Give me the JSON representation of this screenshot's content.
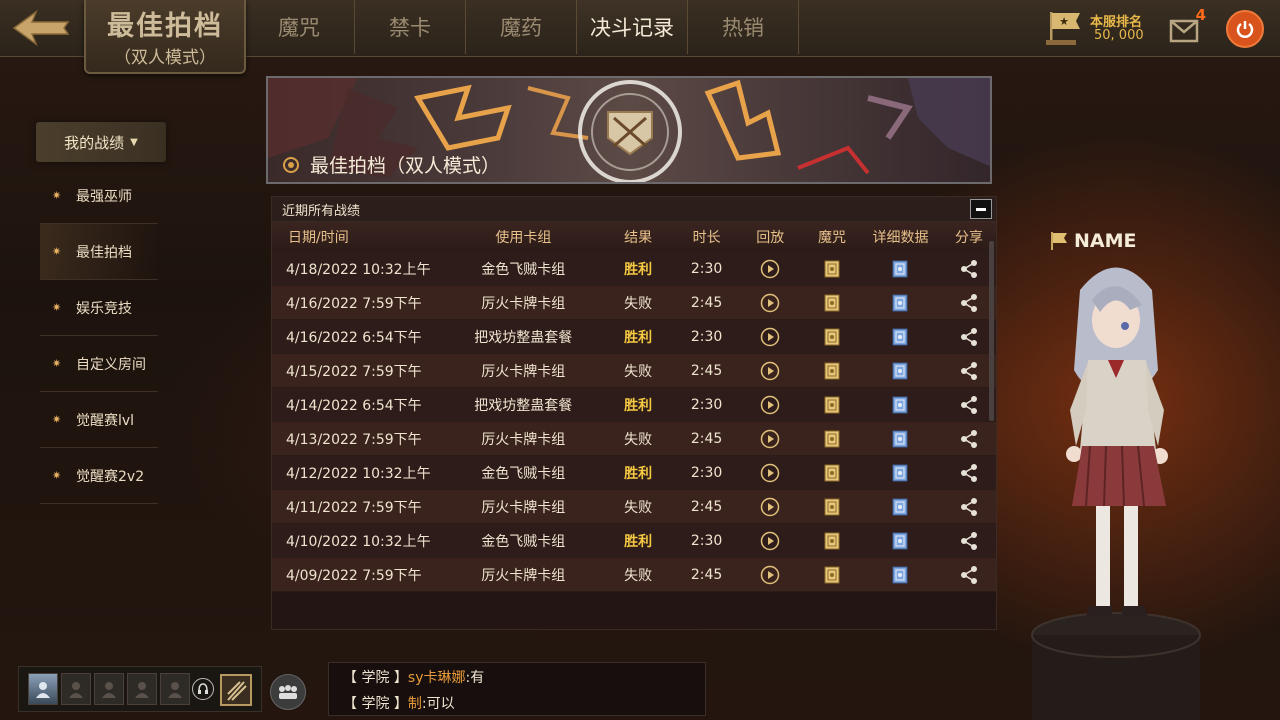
{
  "header": {
    "mode_title": "最佳拍档",
    "mode_subtitle": "（双人模式）",
    "tabs": [
      {
        "label": "魔咒",
        "active": false
      },
      {
        "label": "禁卡",
        "active": false
      },
      {
        "label": "魔药",
        "active": false
      },
      {
        "label": "决斗记录",
        "active": true
      },
      {
        "label": "热销",
        "active": false
      }
    ],
    "rank_label": "本服排名",
    "rank_value": "50, 000",
    "mail_count": "4"
  },
  "sidebar": {
    "header": "我的战绩",
    "items": [
      {
        "label": "最强巫师",
        "active": false
      },
      {
        "label": "最佳拍档",
        "active": true
      },
      {
        "label": "娱乐竞技",
        "active": false
      },
      {
        "label": "自定义房间",
        "active": false
      },
      {
        "label": "觉醒赛lvl",
        "active": false
      },
      {
        "label": "觉醒赛2v2",
        "active": false
      }
    ]
  },
  "banner": {
    "title": "最佳拍档（双人模式）"
  },
  "records": {
    "section_title": "近期所有战绩",
    "columns": {
      "date": "日期/时间",
      "deck": "使用卡组",
      "result": "结果",
      "duration": "时长",
      "replay": "回放",
      "spell": "魔咒",
      "detail": "详细数据",
      "share": "分享"
    },
    "rows": [
      {
        "date": "4/18/2022  10:32上午",
        "deck": "金色飞贼卡组",
        "result": "胜利",
        "win": true,
        "duration": "2:30"
      },
      {
        "date": "4/16/2022   7:59下午",
        "deck": "厉火卡牌卡组",
        "result": "失败",
        "win": false,
        "duration": "2:45"
      },
      {
        "date": "4/16/2022   6:54下午",
        "deck": "把戏坊整蛊套餐",
        "result": "胜利",
        "win": true,
        "duration": "2:30"
      },
      {
        "date": "4/15/2022   7:59下午",
        "deck": "厉火卡牌卡组",
        "result": "失败",
        "win": false,
        "duration": "2:45"
      },
      {
        "date": "4/14/2022   6:54下午",
        "deck": "把戏坊整蛊套餐",
        "result": "胜利",
        "win": true,
        "duration": "2:30"
      },
      {
        "date": "4/13/2022   7:59下午",
        "deck": "厉火卡牌卡组",
        "result": "失败",
        "win": false,
        "duration": "2:45"
      },
      {
        "date": "4/12/2022  10:32上午",
        "deck": "金色飞贼卡组",
        "result": "胜利",
        "win": true,
        "duration": "2:30"
      },
      {
        "date": "4/11/2022   7:59下午",
        "deck": "厉火卡牌卡组",
        "result": "失败",
        "win": false,
        "duration": "2:45"
      },
      {
        "date": "4/10/2022  10:32上午",
        "deck": "金色飞贼卡组",
        "result": "胜利",
        "win": true,
        "duration": "2:30"
      },
      {
        "date": "4/09/2022   7:59下午",
        "deck": "厉火卡牌卡组",
        "result": "失败",
        "win": false,
        "duration": "2:45"
      }
    ]
  },
  "character": {
    "name": "NAME"
  },
  "chat": {
    "messages": [
      {
        "tag": "【 学院 】",
        "sender": "sy卡琳娜",
        "text": ":有"
      },
      {
        "tag": "【 学院 】",
        "sender": "制",
        "text": ":可以"
      }
    ]
  },
  "colors": {
    "win": "#f5c842",
    "lose": "#efe4cf",
    "accent_orange": "#d9541c",
    "gold": "#e8b84a"
  }
}
